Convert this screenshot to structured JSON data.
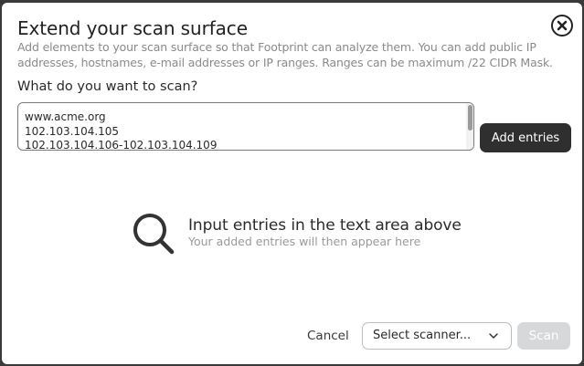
{
  "dialog": {
    "title": "Extend your scan surface",
    "description": "Add elements to your scan surface so that Footprint can analyze them. You can add public IP addresses, hostnames, e-mail addresses or IP ranges. Ranges can be maximum /22 CIDR Mask.",
    "close_icon": "close-circle-icon"
  },
  "input": {
    "label": "What do you want to scan?",
    "value": "www.acme.org\n102.103.104.105\n102.103.104.106-102.103.104.109",
    "add_button_label": "Add entries"
  },
  "empty_state": {
    "icon": "search-icon",
    "title": "Input entries in the text area above",
    "subtitle": "Your added entries will then appear here"
  },
  "footer": {
    "cancel_label": "Cancel",
    "scanner_select_value": "Select scanner...",
    "scan_label": "Scan"
  },
  "colors": {
    "primary_button": "#2f2f2f",
    "disabled_button": "#d6d8da",
    "muted_text": "#8a8a8a"
  }
}
